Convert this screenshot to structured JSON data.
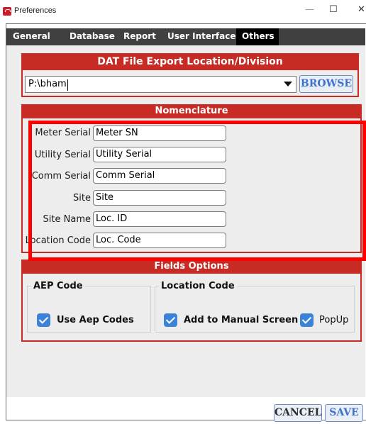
{
  "window": {
    "title": "Preferences",
    "minimize": "—",
    "maximize": "☐",
    "close": "✕"
  },
  "tabs": [
    {
      "label": "General"
    },
    {
      "label": "Database"
    },
    {
      "label": "Report"
    },
    {
      "label": "User Interface"
    },
    {
      "label": "Others",
      "active": true
    }
  ],
  "export": {
    "heading": "DAT File Export Location/Division",
    "path_value": "P:\\bham",
    "browse_label": "BROWSE"
  },
  "nomenclature": {
    "heading": "Nomenclature",
    "fields": [
      {
        "label": "Meter Serial",
        "value": "Meter SN"
      },
      {
        "label": "Utility Serial",
        "value": "Utility Serial"
      },
      {
        "label": "Comm Serial",
        "value": "Comm Serial"
      },
      {
        "label": "Site",
        "value": "Site"
      },
      {
        "label": "Site Name",
        "value": "Loc. ID"
      },
      {
        "label": "Location Code",
        "value": "Loc. Code"
      }
    ]
  },
  "fields_options": {
    "heading": "Fields Options",
    "aep_group": {
      "title": "AEP Code",
      "checkbox_label": "Use Aep Codes",
      "checked": true
    },
    "location_group": {
      "title": "Location Code",
      "manual_label": "Add to Manual Screen",
      "manual_checked": true,
      "popup_label": "PopUp",
      "popup_checked": true
    }
  },
  "footer": {
    "cancel_label": "CANCEL",
    "save_label": "SAVE"
  },
  "colors": {
    "accent_red": "#c82b24",
    "checkbox_blue": "#3b82d8",
    "overlay_red": "#ff0000"
  }
}
